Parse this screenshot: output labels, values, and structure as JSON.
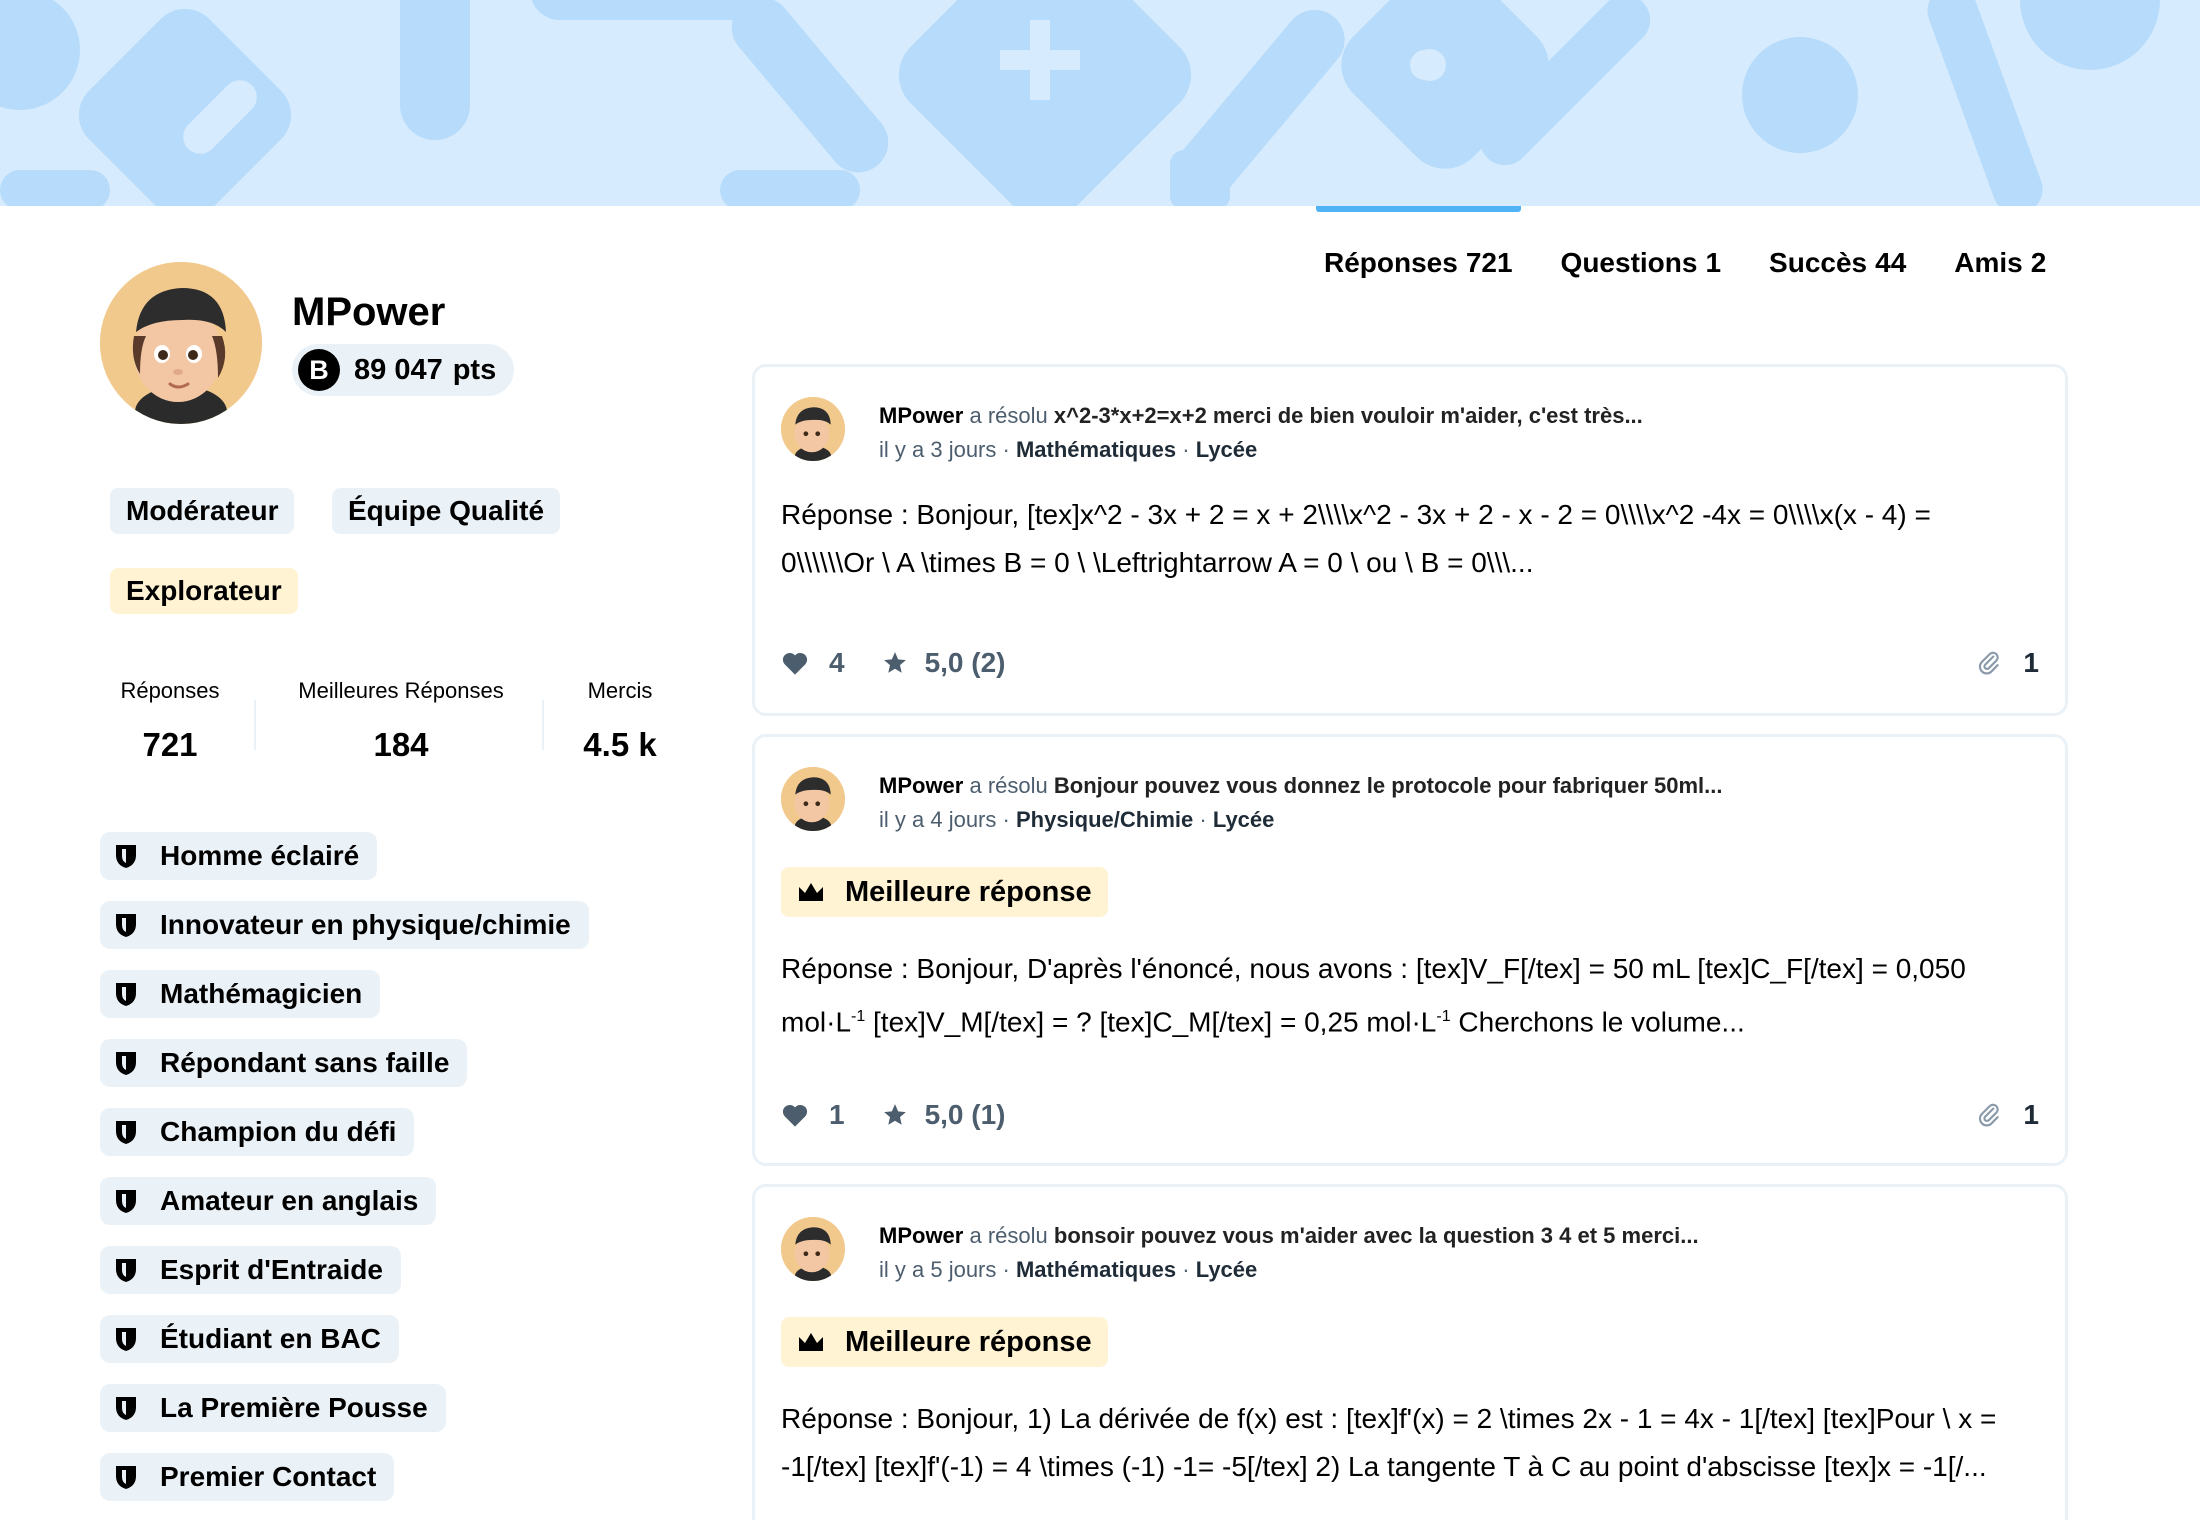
{
  "tabs": [
    {
      "label": "Réponses",
      "count": "721",
      "active": true
    },
    {
      "label": "Questions",
      "count": "1",
      "active": false
    },
    {
      "label": "Succès",
      "count": "44",
      "active": false
    },
    {
      "label": "Amis",
      "count": "2",
      "active": false
    }
  ],
  "profile": {
    "username": "MPower",
    "points_icon": "B",
    "points_value": "89 047",
    "points_unit": "pts",
    "ranks": [
      "Modérateur",
      "Équipe Qualité",
      "Explorateur"
    ]
  },
  "stats": [
    {
      "label": "Réponses",
      "value": "721"
    },
    {
      "label": "Meilleures Réponses",
      "value": "184"
    },
    {
      "label": "Mercis",
      "value": "4.5 k"
    }
  ],
  "achievements": [
    "Homme éclairé",
    "Innovateur en physique/chimie",
    "Mathémagicien",
    "Répondant sans faille",
    "Champion du défi",
    "Amateur en anglais",
    "Esprit d'Entraide",
    "Étudiant en BAC",
    "La Première Pousse",
    "Premier Contact"
  ],
  "answers": [
    {
      "author": "MPower",
      "verb": "a résolu",
      "question": "x^2-3*x+2=x+2 merci de bien vouloir m'aider, c'est très...",
      "time": "il y a 3 jours",
      "subject": "Mathématiques",
      "level": "Lycée",
      "best_label": "",
      "text_line1": "Réponse : Bonjour, [tex]x^2 - 3x + 2 = x + 2\\\\\\\\x^2 - 3x + 2 - x - 2 = 0\\\\\\\\x^2 -4x = 0\\\\\\\\x(x - 4) =",
      "text_line2": "0\\\\\\\\\\\\Or \\ A \\times B = 0 \\ \\Leftrightarrow A = 0 \\ ou \\ B = 0\\\\\\...",
      "likes": "4",
      "rating": "5,0 (2)",
      "attachments": "1"
    },
    {
      "author": "MPower",
      "verb": "a résolu",
      "question": "Bonjour pouvez vous donnez le protocole pour fabriquer 50ml...",
      "time": "il y a 4 jours",
      "subject": "Physique/Chimie",
      "level": "Lycée",
      "best_label": "Meilleure réponse",
      "text_line1": "Réponse : Bonjour, D'après l'énoncé, nous avons : [tex]V_F[/tex] = 50 mL [tex]C_F[/tex] = 0,050",
      "text_line2a": "mol·L",
      "text_line2b": " [tex]V_M[/tex] = ? [tex]C_M[/tex] = 0,25 mol·L",
      "text_line2c": " Cherchons le volume...",
      "superscript": "-1",
      "likes": "1",
      "rating": "5,0 (1)",
      "attachments": "1"
    },
    {
      "author": "MPower",
      "verb": "a résolu",
      "question": "bonsoir pouvez vous m'aider avec la question 3 4 et 5 merci...",
      "time": "il y a 5 jours",
      "subject": "Mathématiques",
      "level": "Lycée",
      "best_label": "Meilleure réponse",
      "text_line1": "Réponse : Bonjour, 1) La dérivée de f(x) est : [tex]f'(x) = 2 \\times 2x - 1 = 4x - 1[/tex] [tex]Pour \\ x =",
      "text_line2": "-1[/tex] [tex]f'(-1) = 4 \\times (-1) -1= -5[/tex] 2) La tangente T à C au point d'abscisse [tex]x = -1[/..."
    }
  ],
  "meta_separator": "·",
  "colors": {
    "banner": "#d6ebfd",
    "banner_shapes": "#a9d4fa",
    "tab_indicator": "#4fb3f6",
    "chip_gray": "#ebf2f7",
    "chip_yellow": "#fff3d4",
    "muted_text": "#4c5d6e"
  }
}
